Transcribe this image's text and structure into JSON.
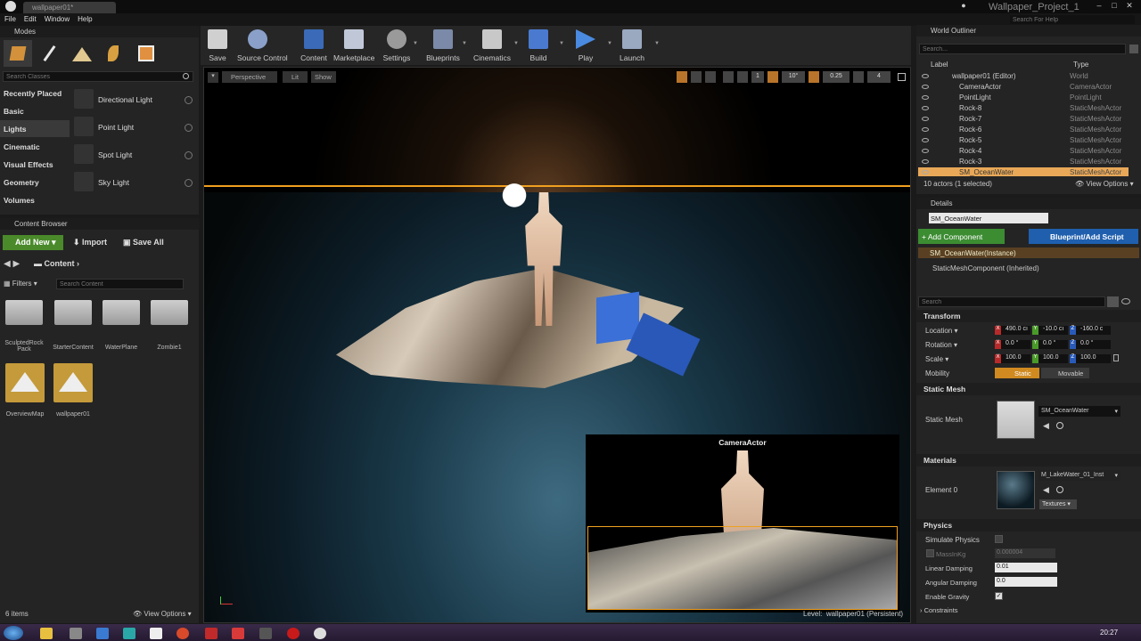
{
  "window": {
    "doc_tab": "wallpaper01*",
    "project_title": "Wallpaper_Project_1",
    "help_search_placeholder": "Search For Help"
  },
  "menu": [
    "File",
    "Edit",
    "Window",
    "Help"
  ],
  "modes": {
    "title": "Modes",
    "search_placeholder": "Search Classes",
    "categories": [
      "Recently Placed",
      "Basic",
      "Lights",
      "Cinematic",
      "Visual Effects",
      "Geometry",
      "Volumes"
    ],
    "items": [
      "Directional Light",
      "Point Light",
      "Spot Light",
      "Sky Light"
    ]
  },
  "toolbar": [
    "Save",
    "Source Control",
    "Content",
    "Marketplace",
    "Settings",
    "Blueprints",
    "Cinematics",
    "Build",
    "Play",
    "Launch"
  ],
  "content_browser": {
    "title": "Content Browser",
    "add_new": "Add New",
    "import": "Import",
    "save_all": "Save All",
    "path": "Content",
    "filters": "Filters",
    "search_placeholder": "Search Content",
    "assets": [
      "SculptedRock Pack",
      "StarterContent",
      "WaterPlane",
      "Zombie1",
      "OverviewMap",
      "wallpaper01"
    ],
    "count": "6 items",
    "view_options": "View Options"
  },
  "viewport": {
    "perspective": "Perspective",
    "lit": "Lit",
    "show": "Show",
    "fov": "10°",
    "snap": "0.25",
    "cam": "4",
    "unit": "1",
    "preview_title": "CameraActor",
    "level_label": "Level:",
    "level_name": "wallpaper01 (Persistent)"
  },
  "outliner": {
    "title": "World Outliner",
    "search_placeholder": "Search...",
    "col_label": "Label",
    "col_type": "Type",
    "rows": [
      {
        "name": "wallpaper01 (Editor)",
        "type": "World"
      },
      {
        "name": "CameraActor",
        "type": "CameraActor"
      },
      {
        "name": "PointLight",
        "type": "PointLight"
      },
      {
        "name": "Rock-8",
        "type": "StaticMeshActor"
      },
      {
        "name": "Rock-7",
        "type": "StaticMeshActor"
      },
      {
        "name": "Rock-6",
        "type": "StaticMeshActor"
      },
      {
        "name": "Rock-5",
        "type": "StaticMeshActor"
      },
      {
        "name": "Rock-4",
        "type": "StaticMeshActor"
      },
      {
        "name": "Rock-3",
        "type": "StaticMeshActor"
      },
      {
        "name": "SM_OceanWater",
        "type": "StaticMeshActor"
      }
    ],
    "status": "10 actors (1 selected)",
    "view_options": "View Options"
  },
  "details": {
    "title": "Details",
    "name": "SM_OceanWater",
    "add_component": "+ Add Component",
    "blueprint": "Blueprint/Add Script",
    "instance": "SM_OceanWater(Instance)",
    "component": "StaticMeshComponent (Inherited)",
    "search_placeholder": "Search",
    "transform": "Transform",
    "location": "Location",
    "rotation": "Rotation",
    "scale": "Scale",
    "mobility": "Mobility",
    "loc": [
      "490.0 cı",
      "-10.0 cı",
      "-160.0 c"
    ],
    "rot": [
      "0.0 °",
      "0.0 °",
      "0.0 °"
    ],
    "scl": [
      "100.0",
      "100.0",
      "100.0"
    ],
    "static": "Static",
    "movable": "Movable",
    "static_mesh_section": "Static Mesh",
    "static_mesh_label": "Static Mesh",
    "static_mesh_value": "SM_OceanWater",
    "materials_section": "Materials",
    "element0": "Element 0",
    "material_value": "M_LakeWater_01_Inst",
    "textures": "Textures",
    "physics_section": "Physics",
    "simulate": "Simulate Physics",
    "mass": "MassInKg",
    "mass_val": "0.000004",
    "linear": "Linear Damping",
    "linear_val": "0.01",
    "angular": "Angular Damping",
    "angular_val": "0.0",
    "gravity": "Enable Gravity",
    "constraints": "Constraints"
  },
  "taskbar": {
    "time": "20:27"
  },
  "colors": {
    "selection": "#f0a020",
    "add_new": "#4a8a2a",
    "blueprint": "#1f5fae",
    "add_component": "#3c8c32"
  }
}
